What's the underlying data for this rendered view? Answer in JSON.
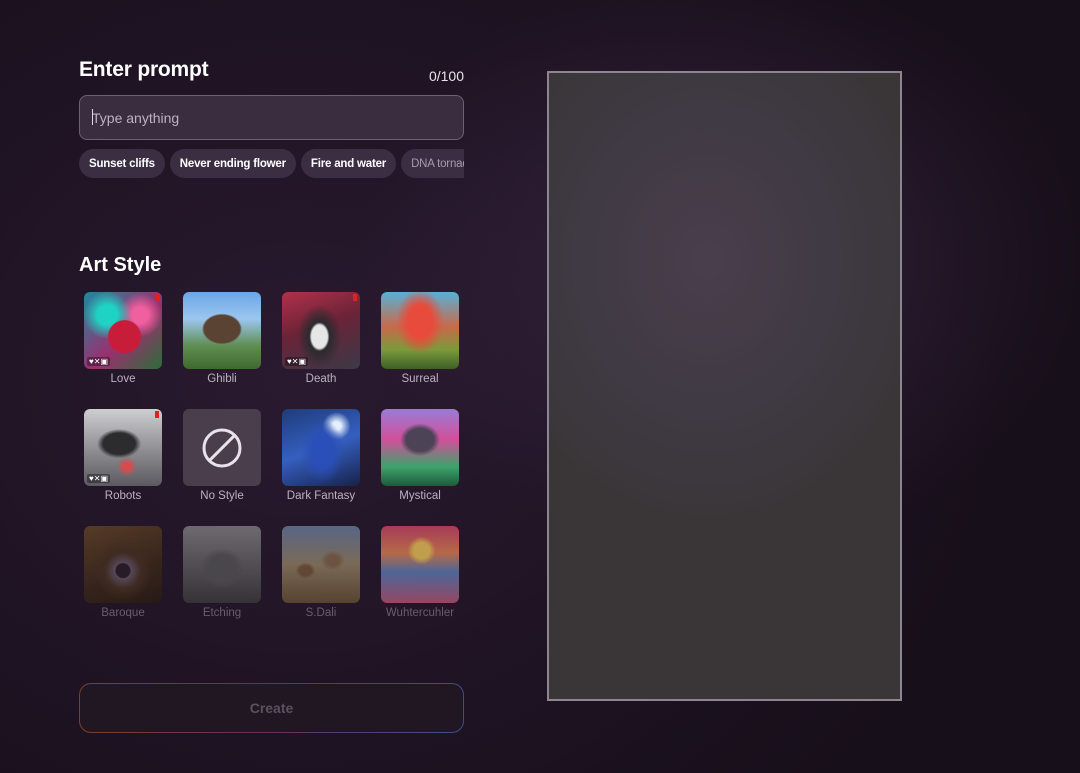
{
  "prompt": {
    "title": "Enter prompt",
    "counter": "0/100",
    "placeholder": "Type anything",
    "value": "",
    "suggestions": [
      "Sunset cliffs",
      "Never ending flower",
      "Fire and water",
      "DNA tornado"
    ]
  },
  "art_style": {
    "title": "Art Style",
    "styles": [
      {
        "label": "Love",
        "icon": "love-thumbnail"
      },
      {
        "label": "Ghibli",
        "icon": "ghibli-thumbnail"
      },
      {
        "label": "Death",
        "icon": "death-thumbnail"
      },
      {
        "label": "Surreal",
        "icon": "surreal-thumbnail"
      },
      {
        "label": "Robots",
        "icon": "robots-thumbnail"
      },
      {
        "label": "No Style",
        "icon": "no-style-icon"
      },
      {
        "label": "Dark Fantasy",
        "icon": "dark-fantasy-thumbnail"
      },
      {
        "label": "Mystical",
        "icon": "mystical-thumbnail"
      },
      {
        "label": "Baroque",
        "icon": "baroque-thumbnail"
      },
      {
        "label": "Etching",
        "icon": "etching-thumbnail"
      },
      {
        "label": "S.Dali",
        "icon": "dali-thumbnail"
      },
      {
        "label": "Wuhtercuhler",
        "icon": "wuhtercuhler-thumbnail"
      }
    ],
    "badge_text": "♥✕▣"
  },
  "actions": {
    "create_label": "Create"
  },
  "colors": {
    "background": "#1e1322",
    "input_bg": "#3a2d40",
    "chip_bg": "#3c2e42",
    "preview_border": "#8d8690"
  }
}
